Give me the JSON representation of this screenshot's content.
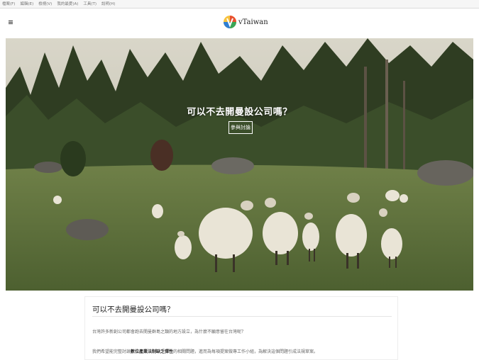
{
  "menubar": {
    "items": [
      "檔案(F)",
      "編輯(E)",
      "檢視(V)",
      "我的最愛(A)",
      "工具(T)",
      "說明(H)"
    ]
  },
  "navbar": {
    "menu_icon": "hamburger-icon",
    "brand_logo": "vtaiwan-logo",
    "brand_name": "vTaiwan"
  },
  "hero": {
    "title": "可以不去開曼設公司嗎？",
    "button_label": "參與討論"
  },
  "article": {
    "title": "可以不去開曼設公司嗎？",
    "para1": "台灣許多新創公司都會跑去開曼群島之類的地方設立，為什麼不願意留在台灣呢？",
    "para2_pre": "我們希望能完整討論",
    "para2_bold": "數位產業法制缺乏彈性",
    "para2_post": "的相關問題，進而為每項提案做專工作小組，為解決這個問題引成法規草案。"
  }
}
